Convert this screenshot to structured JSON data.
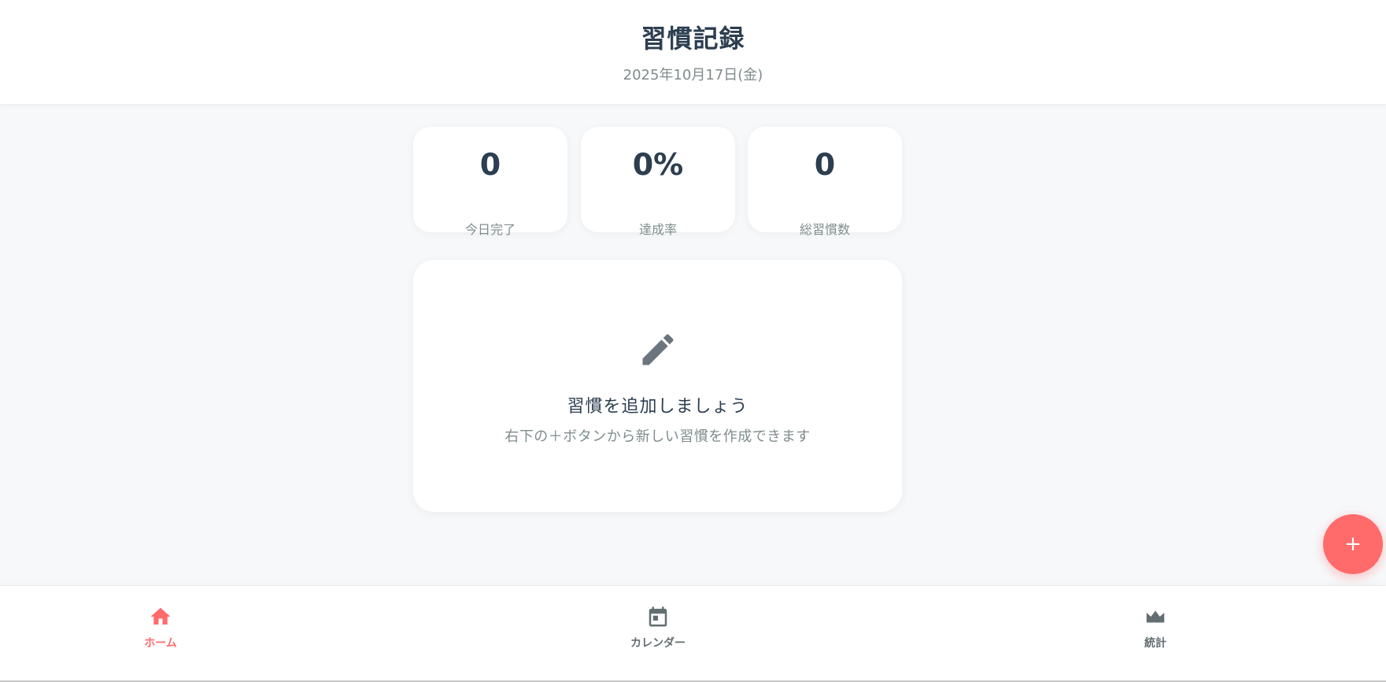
{
  "header": {
    "title": "習慣記録",
    "date": "2025年10月17日(金)"
  },
  "stats": [
    {
      "value": "0",
      "label": "今日完了"
    },
    {
      "value": "0%",
      "label": "達成率"
    },
    {
      "value": "0",
      "label": "総習慣数"
    }
  ],
  "empty_state": {
    "icon": "pencil-icon",
    "title": "習慣を追加しましょう",
    "subtitle": "右下の＋ボタンから新しい習慣を作成できます"
  },
  "fab": {
    "label": "+",
    "color": "#ff6b6b"
  },
  "nav": {
    "items": [
      {
        "label": "ホーム",
        "icon": "home-icon",
        "active": true
      },
      {
        "label": "カレンダー",
        "icon": "calendar-icon",
        "active": false
      },
      {
        "label": "統計",
        "icon": "crown-icon",
        "active": false
      }
    ]
  },
  "colors": {
    "accent": "#ff6b6b",
    "text_dark": "#2c3e50",
    "text_muted": "#7f8c8d",
    "background": "#f7f8fa"
  }
}
